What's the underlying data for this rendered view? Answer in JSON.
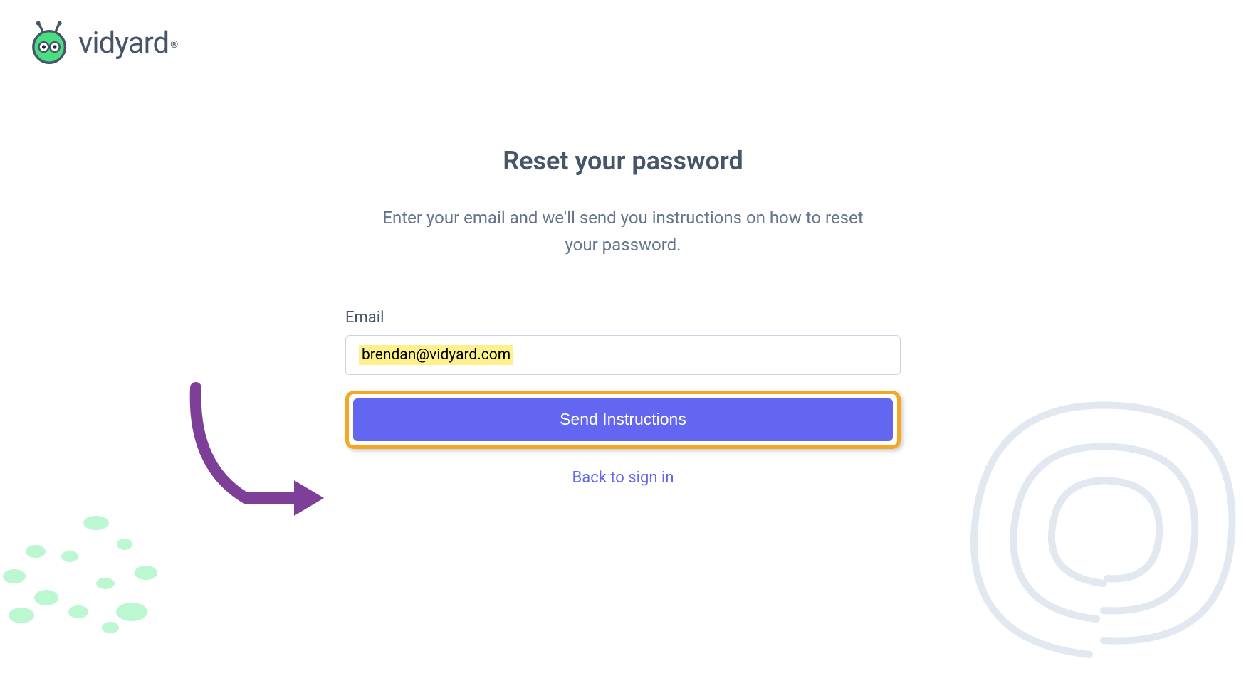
{
  "brand": {
    "name": "vidyard",
    "registered_symbol": "®"
  },
  "page": {
    "title": "Reset your password",
    "instructions": "Enter your email and we'll send you instructions on how to reset your password."
  },
  "form": {
    "email_label": "Email",
    "email_value": "brendan@vidyard.com",
    "submit_label": "Send Instructions",
    "back_label": "Back to sign in"
  },
  "colors": {
    "primary_button": "#6366f1",
    "highlight_border": "#f5a623",
    "text_highlight": "#fef08a",
    "arrow": "#7e3f98",
    "brand_green": "#4ade80"
  }
}
